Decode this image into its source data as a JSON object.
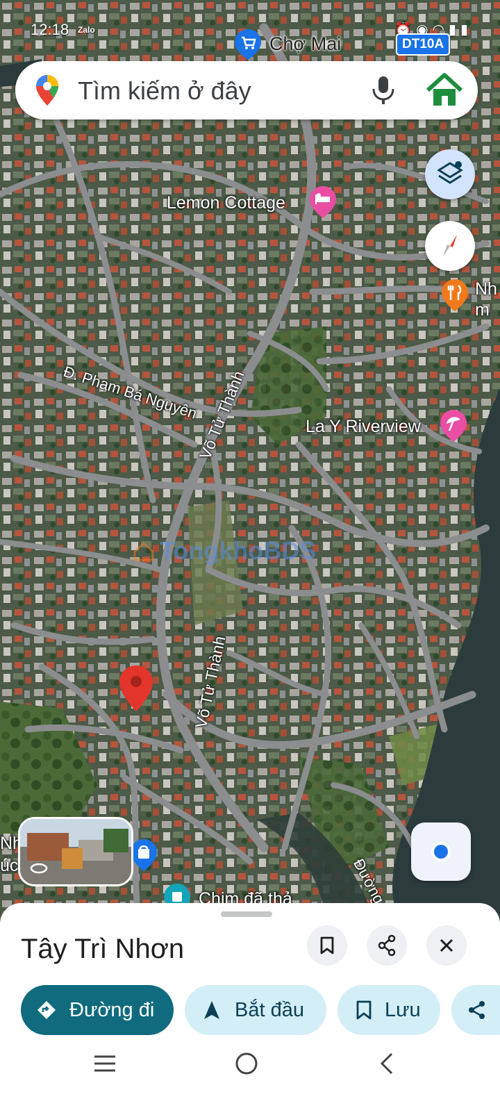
{
  "status_bar": {
    "time": "12:18",
    "app_badge": "Zalo",
    "right_icons": [
      "alarm-icon",
      "location-icon",
      "volte-icon",
      "wifi-icon",
      "signal-icon",
      "battery-icon"
    ]
  },
  "search": {
    "placeholder": "Tìm kiếm ở đây",
    "icons": [
      "maps-pin-icon",
      "mic-icon",
      "home-icon"
    ]
  },
  "map_labels": {
    "cho_mai": "Chợ Mai",
    "route_badge": "DT10A",
    "lemon_cottage": "Lemon Cottage",
    "la_y_riverview": "La Y Riverview",
    "pham_ba_nguyen": "Đ. Phạm Bá Nguyên",
    "vo_tu_thanh_1": "Võ Tử Thành",
    "vo_tu_thanh_2": "Võ Tử Thành",
    "chim_da_tha": "Chim đã thả",
    "duong_partial": "Đường",
    "edge_nh_right": "Nh",
    "edge_m_right": "m",
    "edge_en_left": "ên",
    "edge_nh_left": "Nh",
    "edge_uc_left": "úc"
  },
  "watermark": "TongkhoBDS",
  "sheet": {
    "place_name": "Tây Trì Nhơn",
    "chips": [
      {
        "label": "Đường đi",
        "icon": "directions-icon"
      },
      {
        "label": "Bắt đầu",
        "icon": "navigation-arrow-icon"
      },
      {
        "label": "Lưu",
        "icon": "bookmark-icon"
      },
      {
        "label": "",
        "icon": "share-icon"
      }
    ]
  },
  "colors": {
    "primary_chip": "#0f6b7d",
    "secondary_chip": "#d3eef6",
    "marker_red": "#e3352b",
    "hotel_pink": "#e94ea3",
    "restaurant_orange": "#f07a1b",
    "water": "#2c3c3d"
  }
}
